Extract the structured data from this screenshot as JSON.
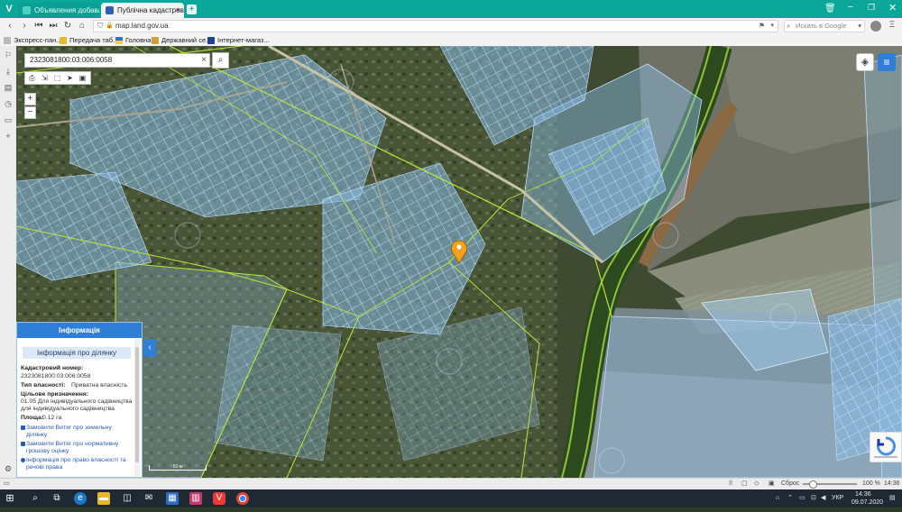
{
  "browser": {
    "tabs": [
      {
        "label": "Объявления добавляется",
        "active": false
      },
      {
        "label": "Публічна кадастрова карт",
        "active": true
      }
    ],
    "new_tab": "+",
    "address": "map.land.gov.ua",
    "search_placeholder": "Искать в Google",
    "bookmarks": [
      "Экспресс-пан...",
      "Передача таб...",
      "Головна",
      "Державний се...",
      "Інтернет-магаз..."
    ]
  },
  "map": {
    "search_value": "2323081800:03:006:0058",
    "zoom_in": "+",
    "zoom_out": "−",
    "scale_label": "50 м"
  },
  "info_panel": {
    "header": "Інформація",
    "subtitle": "Інформація про ділянку",
    "cadastral_label": "Кадастровий номер:",
    "cadastral_value": "2323081800:03:006:0058",
    "ownership_label": "Тип власності:",
    "ownership_value": "Приватна власність",
    "purpose_label": "Цільове призначення:",
    "purpose_value": "01.05 Для індивідуального садівництва для індивідуального садівництва",
    "area_label": "Площа:",
    "area_value": "0.12 га",
    "links": [
      "Замовити Витяг про земельну ділянку",
      "Замовити Витяг про нормативну грошову оцінку",
      "Інформація про право власності та речові права"
    ],
    "collapse": "‹"
  },
  "statusbar": {
    "reset": "Сброс",
    "zoom": "100 %",
    "time": "14:36"
  },
  "taskbar": {
    "lang": "УКР",
    "time": "14:36",
    "date": "09.07.2020"
  },
  "colors": {
    "tabbar": "#0aa79a",
    "accent": "#2f7fd8",
    "parcel_fill": "#7fb7e8",
    "boundary": "#b9e63a"
  }
}
